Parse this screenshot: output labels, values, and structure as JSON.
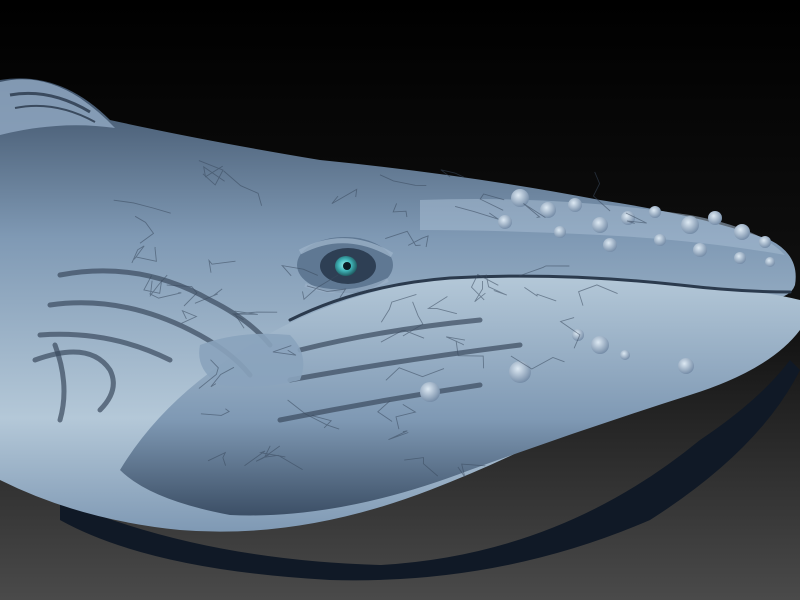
{
  "scene": {
    "subject": "whale-head-3d-sculpt",
    "colors": {
      "background_top": "#000000",
      "background_bottom": "#4a4a4a",
      "skin_light": "#b4c8d8",
      "skin_mid": "#7f99b4",
      "skin_dark": "#3c4f66",
      "belly_shadow": "#101926",
      "eye_iris": "#3fb2b6",
      "eye_pupil": "#0b1a22",
      "crease": "#3a4a5e"
    }
  }
}
